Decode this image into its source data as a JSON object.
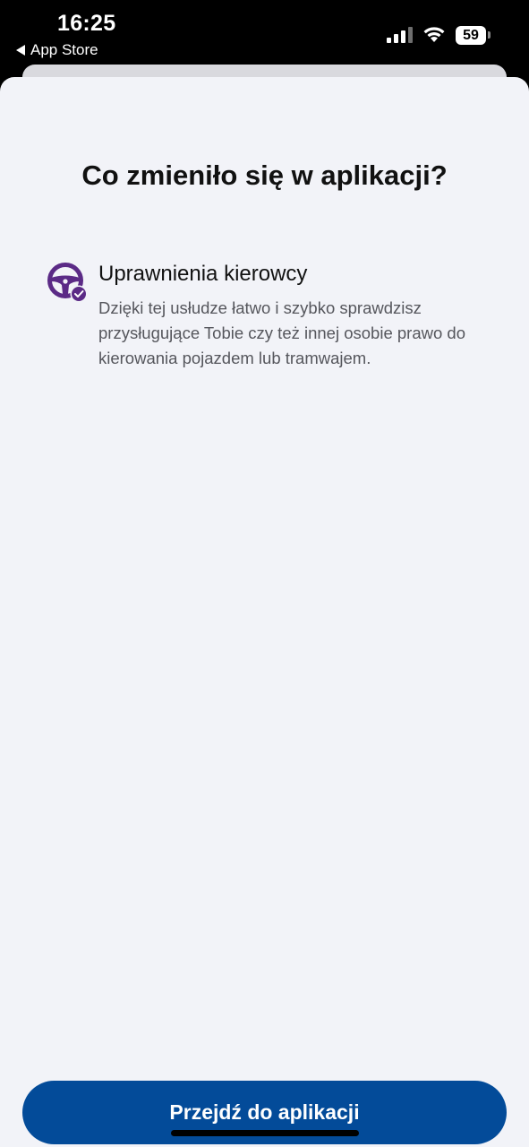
{
  "status_bar": {
    "time": "16:25",
    "back_label": "App Store",
    "battery_level": "59",
    "icons": [
      "signal-icon",
      "wifi-icon",
      "battery-icon"
    ]
  },
  "sheet": {
    "title": "Co zmieniło się w aplikacji?",
    "features": [
      {
        "icon": "steering-wheel-check-icon",
        "title": "Uprawnienia kierowcy",
        "description": "Dzięki tej usłudze łatwo i szybko sprawdzisz przysługujące Tobie czy też innej osobie prawo do kierowania pojazdem lub tramwajem."
      }
    ],
    "cta_label": "Przejdź do aplikacji"
  },
  "colors": {
    "accent": "#034b99",
    "icon_purple": "#5b2a86",
    "background": "#f2f3f8"
  }
}
